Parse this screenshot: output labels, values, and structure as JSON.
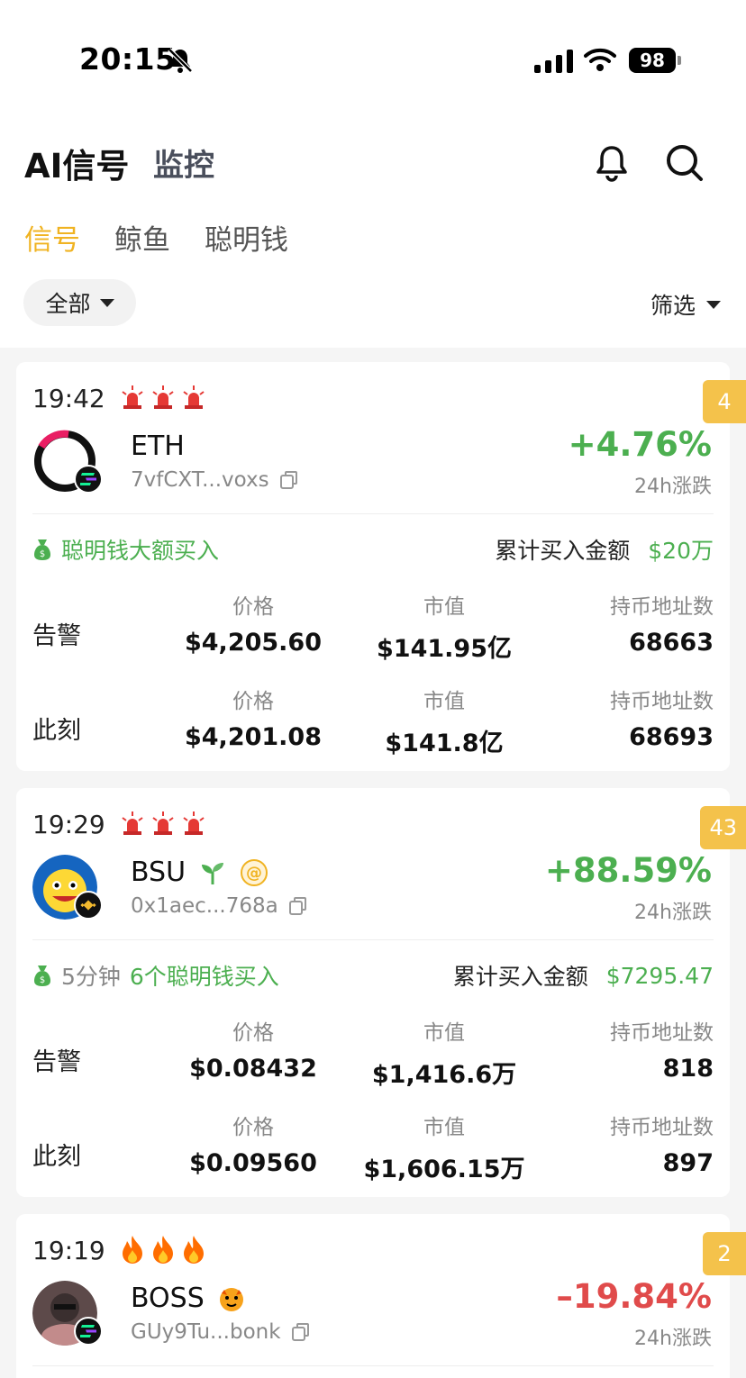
{
  "status_bar": {
    "time": "20:15",
    "battery": "98"
  },
  "header": {
    "main_tabs": [
      "AI信号",
      "监控"
    ],
    "sub_tabs": [
      "信号",
      "鲸鱼",
      "聪明钱"
    ],
    "filter_all": "全部",
    "filter_screen": "筛选"
  },
  "colors": {
    "accent": "#f0b322",
    "up": "#4caf50",
    "down": "#e04b4b",
    "badge": "#f4c24b"
  },
  "cards": [
    {
      "time": "19:42",
      "alarm_icon": "siren-icon",
      "badge": "4",
      "token": "ETH",
      "address": "7vfCXT...voxs",
      "change": "+4.76%",
      "change_label": "24h涨跌",
      "signal_prefix": "",
      "signal_text": "聪明钱大额买入",
      "cum_label": "累计买入金额",
      "cum_value": "$20万",
      "alert_label": "告警",
      "now_label": "此刻",
      "price_label": "价格",
      "mcap_label": "市值",
      "holders_label": "持币地址数",
      "alert": {
        "price": "$4,205.60",
        "mcap": "$141.95亿",
        "holders": "68663"
      },
      "now": {
        "price": "$4,201.08",
        "mcap": "$141.8亿",
        "holders": "68693"
      }
    },
    {
      "time": "19:29",
      "alarm_icon": "siren-icon",
      "badge": "43",
      "token": "BSU",
      "address": "0x1aec...768a",
      "change": "+88.59%",
      "change_label": "24h涨跌",
      "signal_prefix": "5分钟",
      "signal_text": "6个聪明钱买入",
      "cum_label": "累计买入金额",
      "cum_value": "$7295.47",
      "alert_label": "告警",
      "now_label": "此刻",
      "price_label": "价格",
      "mcap_label": "市值",
      "holders_label": "持币地址数",
      "alert": {
        "price": "$0.08432",
        "mcap": "$1,416.6万",
        "holders": "818"
      },
      "now": {
        "price": "$0.09560",
        "mcap": "$1,606.15万",
        "holders": "897"
      }
    },
    {
      "time": "19:19",
      "alarm_icon": "fire-icon",
      "badge": "2",
      "token": "BOSS",
      "address": "GUy9Tu...bonk",
      "change": "–19.84%",
      "change_label": "24h涨跌"
    }
  ]
}
